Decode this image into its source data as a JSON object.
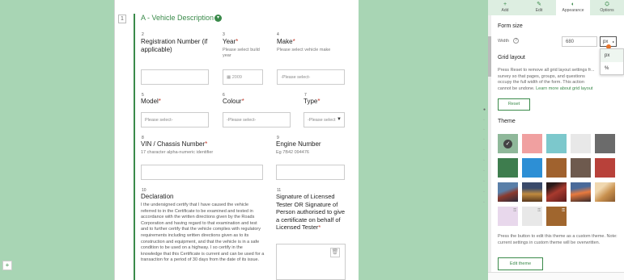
{
  "section": {
    "page_number": "1",
    "title": "A - Vehicle Description",
    "toggle_glyph": "▾"
  },
  "questions": {
    "q2": {
      "num": "2",
      "label": "Registration Number (if applicable)"
    },
    "q3": {
      "num": "3",
      "label": "Year",
      "hint": "Please select build year",
      "placeholder": "2009"
    },
    "q4": {
      "num": "4",
      "label": "Make",
      "hint": "Please select vehicle make",
      "select": "-Please select-"
    },
    "q5": {
      "num": "5",
      "label": "Model",
      "select": "Please select-"
    },
    "q6": {
      "num": "6",
      "label": "Colour",
      "select": "-Please select-"
    },
    "q7": {
      "num": "7",
      "label": "Type",
      "select": "-Please select"
    },
    "q8": {
      "num": "8",
      "label": "VIN / Chassis Number",
      "hint": "17 character alpha-numeric identifier"
    },
    "q9": {
      "num": "9",
      "label": "Engine Number",
      "hint": "Eg 7B42 094476"
    },
    "q10": {
      "num": "10",
      "label": "Declaration",
      "text": "I the undersigned certify that I have caused the vehicle referred to in the Certificate to be examined and tested in accordance with the written directions given by the Roads Corporation and having regard to that examination and test and to further certify that the vehicle complies with regulatory requirements including written directions given as to its construction and equipment, and that the vehicle is in a safe condition to be used on a highway. I so certify in the knowledge that this Certificate is current and can be used for a transaction for a period of 30 days from the date of its issue."
    },
    "q11": {
      "num": "11",
      "label": "Signature of Licensed Tester OR Signature of Person authorised to give a certificate on behalf of Licensed Tester"
    }
  },
  "req_mark": "*",
  "panel": {
    "tabs": [
      {
        "label": "Add",
        "icon": "+"
      },
      {
        "label": "Edit",
        "icon": "✎"
      },
      {
        "label": "Appearance",
        "icon": "◐"
      },
      {
        "label": "Options",
        "icon": "⛭"
      }
    ],
    "form_size_heading": "Form size",
    "width_label": "Width",
    "help_glyph": "?",
    "width_value": "680",
    "unit_value": "px",
    "unit_options": [
      "px",
      "%"
    ],
    "grid_heading": "Grid layout",
    "grid_text": "Press Reset to remove all grid layout settings fr... survey so that pages, groups, and questions occupy the full width of the form. This action cannot be undone.",
    "grid_link": "Learn more about grid layout",
    "reset_label": "Reset",
    "theme_heading": "Theme",
    "theme_text": "Press the button to edit this theme as a custom theme. Note: current settings in custom theme will be overwritten.",
    "edit_theme_label": "Edit theme"
  },
  "swatches_row1": [
    "#8fb89a",
    "#f0a0a0",
    "#7cc8cc",
    "#e8e8e8",
    "#6b6b6b"
  ],
  "swatches_row2": [
    "#3e7d4e",
    "#2d8fd5",
    "#a0622e",
    "#6e5a4e",
    "#b8413a"
  ],
  "swatches_row3": [
    "#4a6a8a",
    "#b0762e",
    "#8a3a2e",
    "#c46a3e",
    "#d8b888"
  ],
  "swatches_row4": [
    "#e8d8ec",
    "#e8e8e8",
    "#a0662e"
  ],
  "colors": {
    "accent": "#3a8a4a",
    "canvas": "#a8d5b4"
  }
}
